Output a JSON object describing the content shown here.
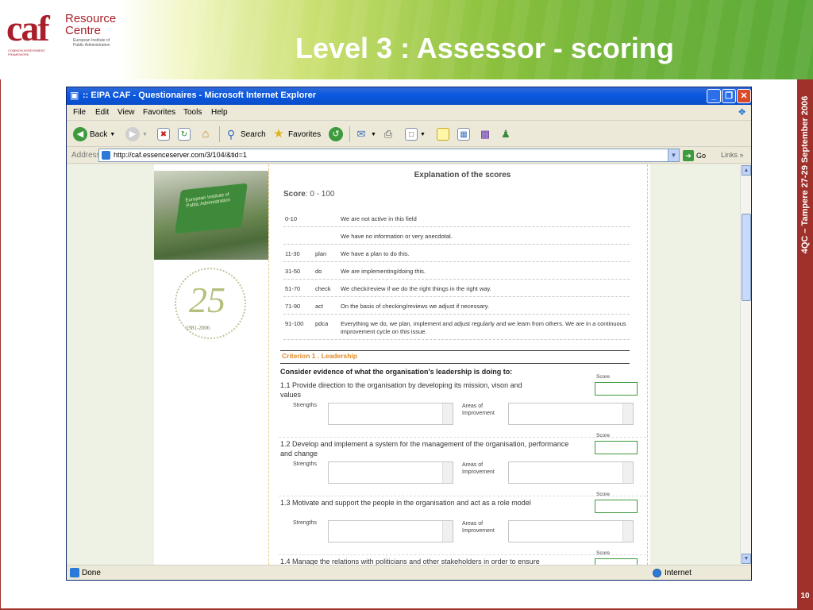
{
  "slide": {
    "title": "Level 3 : Assessor - scoring",
    "side_text": "4QC – Tampere 27-29 September 2006",
    "page_number": "10",
    "logo": {
      "caf": "caf",
      "resource": "Resource",
      "centre": "Centre",
      "sub": "European Institute of Public Administration",
      "tiny": "COMMON ASSESSMENT FRAMEWORK"
    }
  },
  "browser": {
    "title": ":: EIPA CAF - Questionaires - Microsoft Internet Explorer",
    "menu": [
      "File",
      "Edit",
      "View",
      "Favorites",
      "Tools",
      "Help"
    ],
    "toolbar": {
      "back": "Back",
      "search": "Search",
      "favorites": "Favorites"
    },
    "address_label": "Address",
    "url": "http://caf.essenceserver.com/3/104/&tid=1",
    "go": "Go",
    "links": "Links",
    "status": "Done",
    "zone": "Internet"
  },
  "page": {
    "flag_text": "European Institute of Public Administration",
    "emblem_number": "25",
    "emblem_years": "1981-2006",
    "explanation_title": "Explanation of the scores",
    "score_label": "Score",
    "score_range": ": 0 - 100",
    "score_rows": [
      {
        "range": "0-10",
        "phase": "",
        "text": "We are not active in this field"
      },
      {
        "range": "",
        "phase": "",
        "text": "We have no information or very anecdotal."
      },
      {
        "range": "11-30",
        "phase": "plan",
        "text": "We have a plan to do this."
      },
      {
        "range": "31-50",
        "phase": "do",
        "text": "We are implementing/doing this."
      },
      {
        "range": "51-70",
        "phase": "check",
        "text": "We check/review if we do the right things in the right way."
      },
      {
        "range": "71-90",
        "phase": "act",
        "text": "On the basis of checking/reviews we adjust if necessary."
      },
      {
        "range": "91-100",
        "phase": "pdca",
        "text": "Everything we do, we plan, implement and adjust regularly and we learn from others. We are in a continuous improvement cycle on this issue."
      }
    ],
    "criterion_title": "Criterion 1 . Leadership",
    "consider": "Consider evidence of what the organisation's leadership is doing to:",
    "score_field_label": "Score",
    "strengths_label": "Strengths",
    "areas_label": "Areas of Improvement",
    "items": [
      {
        "text": "1.1 Provide direction to the organisation by developing its mission, vison and values"
      },
      {
        "text": "1.2 Develop and implement a system for the management of the organisation, performance and change"
      },
      {
        "text": "1.3 Motivate and support the people in the organisation and act as a role model"
      },
      {
        "text": "1.4 Manage the relations with politicians and other stakeholders in order to ensure"
      }
    ]
  },
  "colors": {
    "accent_red": "#a0302a",
    "caf_red": "#a81f2b",
    "criterion_orange": "#e08a2a",
    "score_box_green": "#3c9a3c"
  }
}
